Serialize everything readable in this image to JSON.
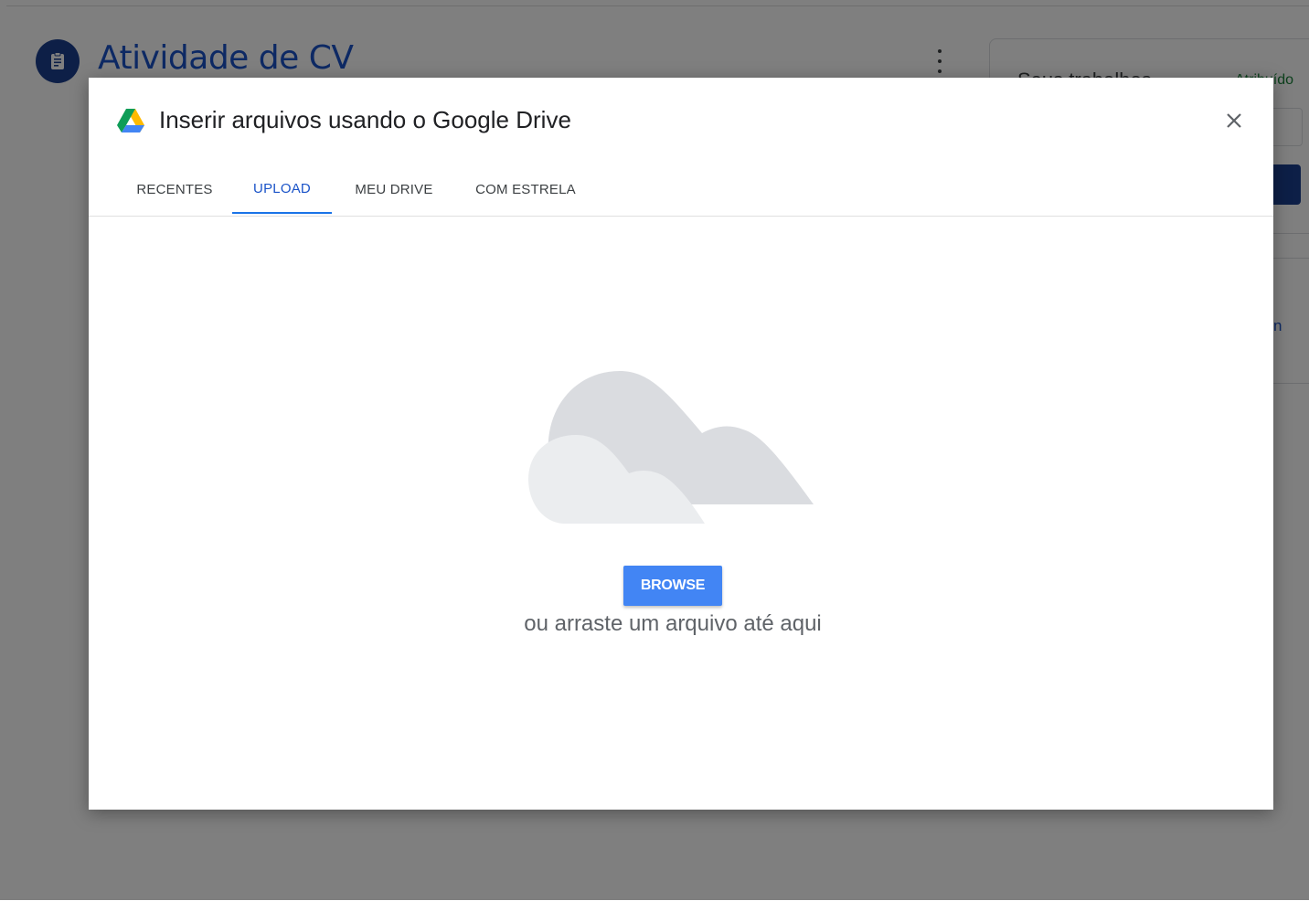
{
  "background": {
    "page_title": "Atividade de CV",
    "side_card": {
      "title": "Seus trabalhos",
      "status": "Atribuído",
      "link_text": "n"
    }
  },
  "dialog": {
    "title": "Inserir arquivos usando o Google Drive",
    "tabs": [
      {
        "label": "RECENTES",
        "active": false
      },
      {
        "label": "UPLOAD",
        "active": true
      },
      {
        "label": "MEU DRIVE",
        "active": false
      },
      {
        "label": "COM ESTRELA",
        "active": false
      }
    ],
    "browse_label": "BROWSE",
    "drag_hint": "ou arraste um arquivo até aqui"
  },
  "colors": {
    "accent": "#1a73e8",
    "browse_button": "#4285f4",
    "title_blue": "#1a53c8",
    "status_green": "#188038"
  },
  "icons": [
    "assignment-icon",
    "more-vert-icon",
    "google-drive-icon",
    "close-icon",
    "cloud-illustration"
  ]
}
